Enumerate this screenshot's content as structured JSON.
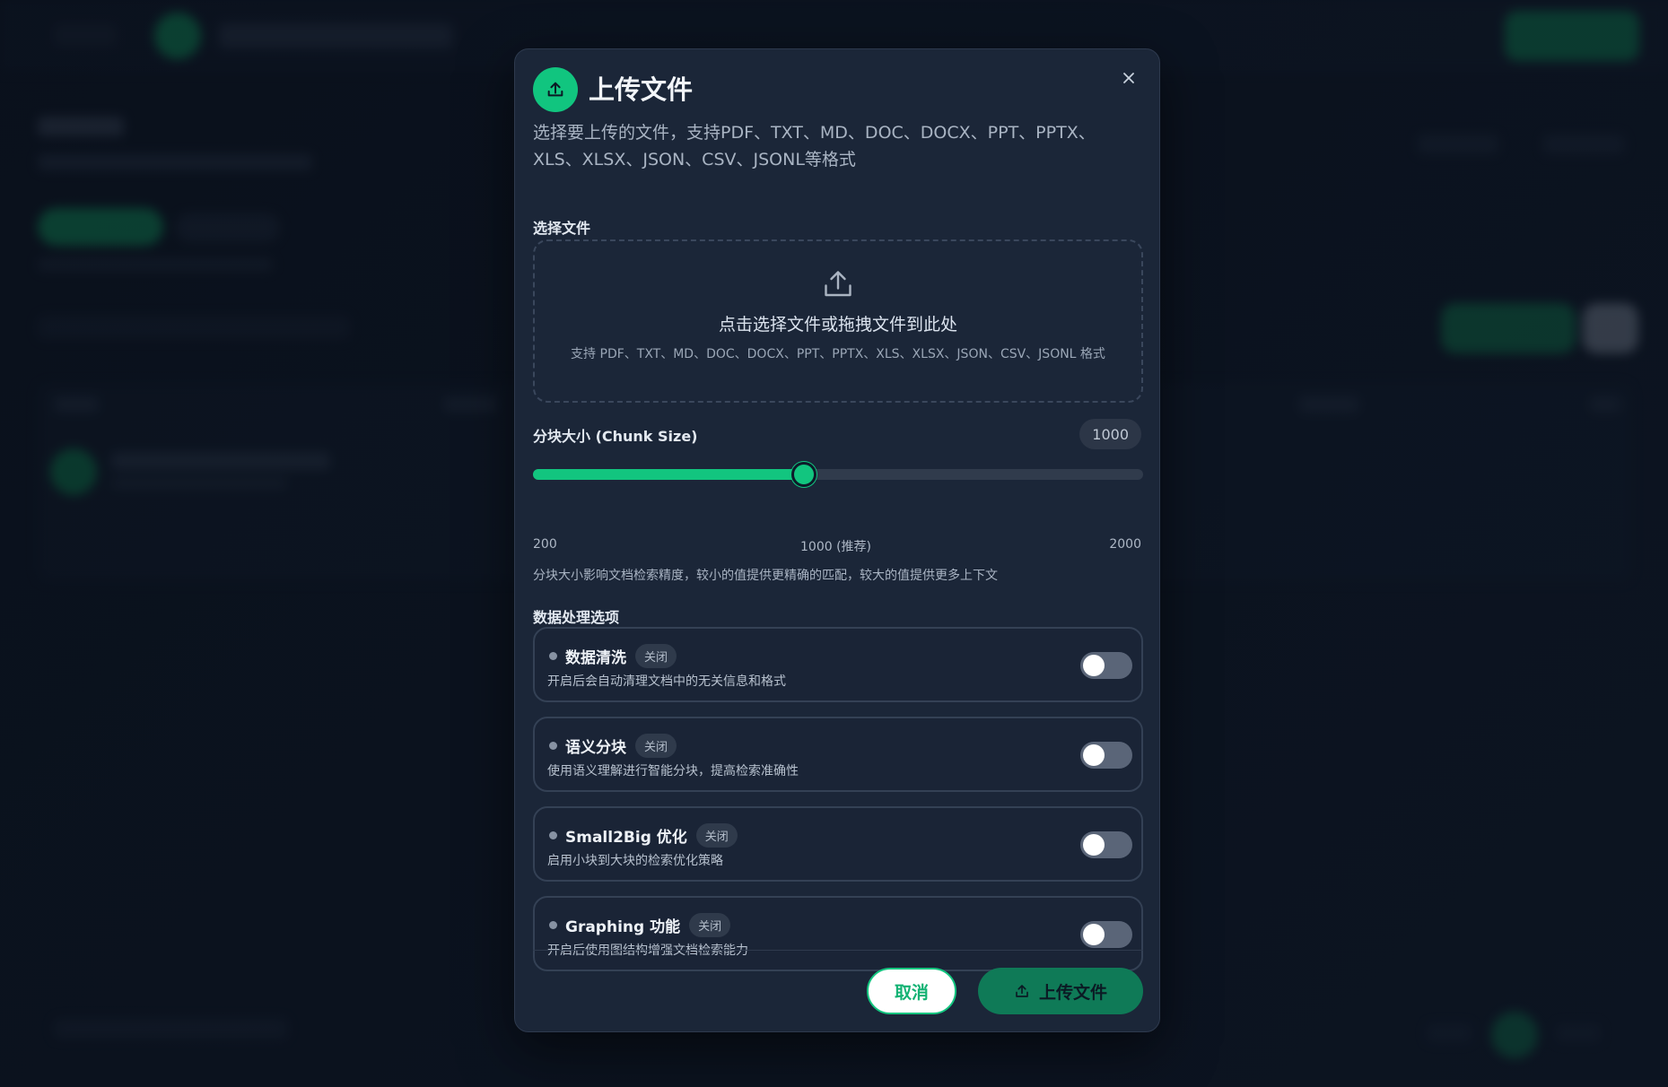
{
  "modal": {
    "title": "上传文件",
    "description": "选择要上传的文件，支持PDF、TXT、MD、DOC、DOCX、PPT、PPTX、XLS、XLSX、JSON、CSV、JSONL等格式",
    "close_label": "×"
  },
  "file_select": {
    "label": "选择文件",
    "drop_main": "点击选择文件或拖拽文件到此处",
    "drop_sub": "支持 PDF、TXT、MD、DOC、DOCX、PPT、PPTX、XLS、XLSX、JSON、CSV、JSONL 格式"
  },
  "chunk": {
    "label": "分块大小 (Chunk Size)",
    "value": 1000,
    "min": 200,
    "max": 2000,
    "tick_min": "200",
    "tick_mid": "1000 (推荐)",
    "tick_max": "2000",
    "help": "分块大小影响文档检索精度，较小的值提供更精确的匹配，较大的值提供更多上下文"
  },
  "processing": {
    "label": "数据处理选项",
    "options": [
      {
        "title": "数据清洗",
        "badge": "关闭",
        "desc": "开启后会自动清理文档中的无关信息和格式",
        "enabled": false
      },
      {
        "title": "语义分块",
        "badge": "关闭",
        "desc": "使用语义理解进行智能分块，提高检索准确性",
        "enabled": false
      },
      {
        "title": "Small2Big 优化",
        "badge": "关闭",
        "desc": "启用小块到大块的检索优化策略",
        "enabled": false
      },
      {
        "title": "Graphing 功能",
        "badge": "关闭",
        "desc": "开启后使用图结构增强文档检索能力",
        "enabled": false
      }
    ]
  },
  "actions": {
    "cancel": "取消",
    "upload": "上传文件"
  },
  "colors": {
    "accent": "#12c57f",
    "upload_button": "#0f7a57",
    "modal_bg": "#1b2638"
  }
}
